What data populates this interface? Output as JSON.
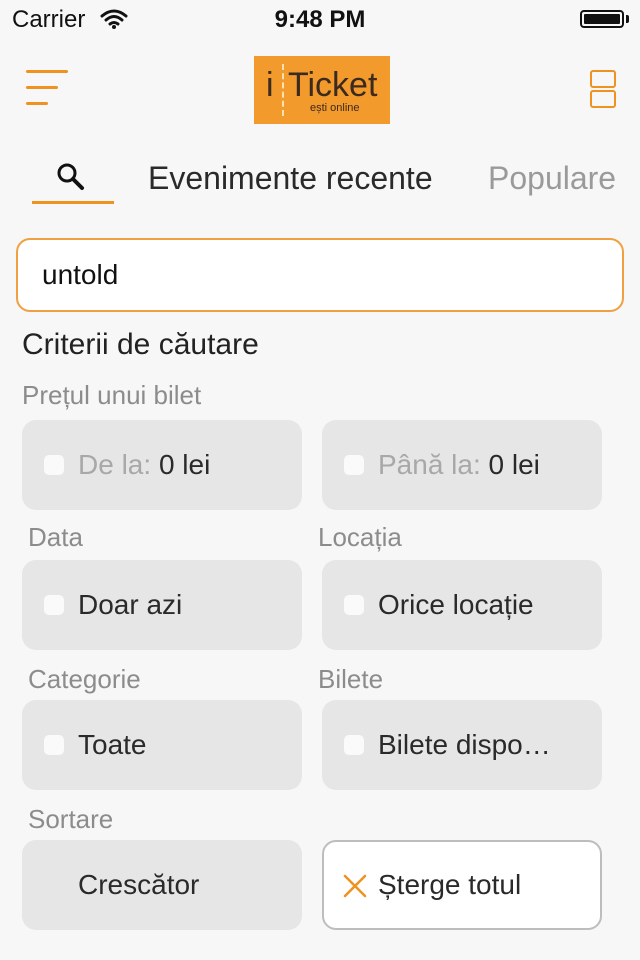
{
  "status_bar": {
    "carrier": "Carrier",
    "time": "9:48 PM"
  },
  "logo": {
    "i": "i",
    "ticket": "Ticket",
    "tagline": "ești online"
  },
  "tabs": {
    "recent": "Evenimente recente",
    "popular": "Populare"
  },
  "search": {
    "value": "untold"
  },
  "criteria": {
    "title": "Criterii de căutare",
    "price_label": "Prețul unui bilet",
    "from_prefix": "De la:",
    "from_value": "0 lei",
    "to_prefix": "Până la:",
    "to_value": "0 lei",
    "date_label": "Data",
    "date_value": "Doar azi",
    "location_label": "Locația",
    "location_value": "Orice locație",
    "category_label": "Categorie",
    "category_value": "Toate",
    "tickets_label": "Bilete",
    "tickets_value": "Bilete dispo…",
    "sort_label": "Sortare",
    "sort_value": "Crescător",
    "clear_label": "Șterge totul"
  },
  "colors": {
    "accent": "#f0921f",
    "box": "#e6e6e6",
    "muted_text": "#8c8c8c"
  }
}
